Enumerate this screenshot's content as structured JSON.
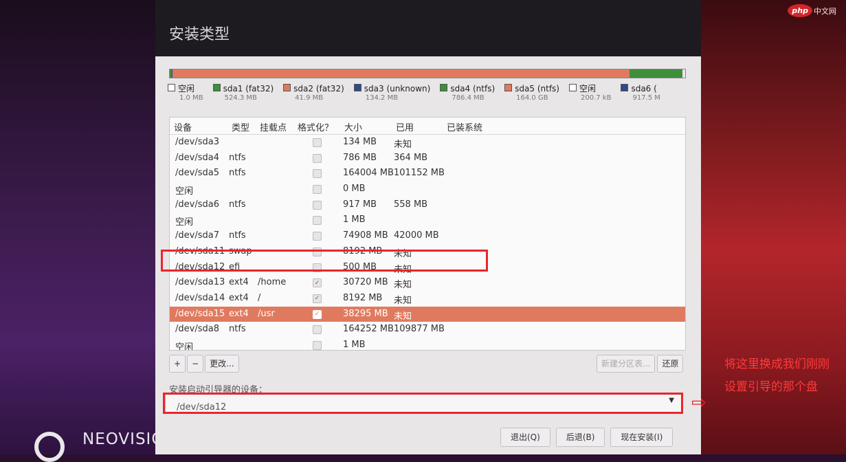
{
  "page": {
    "title": "安装类型"
  },
  "watermark": {
    "logo_text": "php",
    "logo_suffix": "中文网",
    "brand": "NEOVISION"
  },
  "disk_bar": {
    "segments": [
      {
        "color": "#cfcfcf",
        "frac": 0.0005
      },
      {
        "color": "#3e8e3a",
        "frac": 0.003
      },
      {
        "color": "#e07a5f",
        "frac": 0.0007
      },
      {
        "color": "#2e4b8a",
        "frac": 0.0005
      },
      {
        "color": "#3e8e3a",
        "frac": 0.0005
      },
      {
        "color": "#e07a5f",
        "frac": 0.887
      },
      {
        "color": "#3e8e3a",
        "frac": 0.103
      }
    ]
  },
  "legend": [
    {
      "name": "空闲",
      "size": "1.0 MB",
      "color": "#ffffff"
    },
    {
      "name": "sda1 (fat32)",
      "size": "524.3 MB",
      "color": "#3e8e3a"
    },
    {
      "name": "sda2 (fat32)",
      "size": "41.9 MB",
      "color": "#e07a5f"
    },
    {
      "name": "sda3 (unknown)",
      "size": "134.2 MB",
      "color": "#2e4b8a"
    },
    {
      "name": "sda4 (ntfs)",
      "size": "786.4 MB",
      "color": "#3e8e3a"
    },
    {
      "name": "sda5 (ntfs)",
      "size": "164.0 GB",
      "color": "#e07a5f"
    },
    {
      "name": "空闲",
      "size": "200.7 kB",
      "color": "#ffffff"
    },
    {
      "name": "sda6 (",
      "size": "917.5 M",
      "color": "#2e4b8a"
    }
  ],
  "table": {
    "headers": {
      "device": "设备",
      "type": "类型",
      "mount": "挂载点",
      "format": "格式化？",
      "size": "大小",
      "used": "已用",
      "installed": "已装系统"
    },
    "rows": [
      {
        "device": "/dev/sda3",
        "type": "",
        "mount": "",
        "format": false,
        "size": "134 MB",
        "used": "未知"
      },
      {
        "device": "/dev/sda4",
        "type": "ntfs",
        "mount": "",
        "format": false,
        "size": "786 MB",
        "used": "364 MB"
      },
      {
        "device": "/dev/sda5",
        "type": "ntfs",
        "mount": "",
        "format": false,
        "size": "164004 MB",
        "used": "101152 MB"
      },
      {
        "device": "空闲",
        "type": "",
        "mount": "",
        "format": false,
        "size": "0 MB",
        "used": ""
      },
      {
        "device": "/dev/sda6",
        "type": "ntfs",
        "mount": "",
        "format": false,
        "size": "917 MB",
        "used": "558 MB"
      },
      {
        "device": "空闲",
        "type": "",
        "mount": "",
        "format": false,
        "size": "1 MB",
        "used": ""
      },
      {
        "device": "/dev/sda7",
        "type": "ntfs",
        "mount": "",
        "format": false,
        "size": "74908 MB",
        "used": "42000 MB"
      },
      {
        "device": "/dev/sda11",
        "type": "swap",
        "mount": "",
        "format": false,
        "size": "8192 MB",
        "used": "未知"
      },
      {
        "device": "/dev/sda12",
        "type": "efi",
        "mount": "",
        "format": false,
        "size": "500 MB",
        "used": "未知"
      },
      {
        "device": "/dev/sda13",
        "type": "ext4",
        "mount": "/home",
        "format": true,
        "size": "30720 MB",
        "used": "未知"
      },
      {
        "device": "/dev/sda14",
        "type": "ext4",
        "mount": "/",
        "format": true,
        "size": "8192 MB",
        "used": "未知"
      },
      {
        "device": "/dev/sda15",
        "type": "ext4",
        "mount": "/usr",
        "format": true,
        "size": "38295 MB",
        "used": "未知",
        "selected": true
      },
      {
        "device": "/dev/sda8",
        "type": "ntfs",
        "mount": "",
        "format": false,
        "size": "164252 MB",
        "used": "109877 MB"
      },
      {
        "device": "空闲",
        "type": "",
        "mount": "",
        "format": false,
        "size": "1 MB",
        "used": ""
      }
    ]
  },
  "table_buttons": {
    "add": "+",
    "remove": "−",
    "change": "更改...",
    "new_table": "新建分区表...",
    "revert": "还原"
  },
  "bootloader": {
    "label": "安装启动引导器的设备：",
    "value": "/dev/sda12"
  },
  "bottom_buttons": {
    "quit": "退出(Q)",
    "back": "后退(B)",
    "install": "现在安装(I)"
  },
  "annotation": {
    "text": "将这里换成我们刚刚设置引导的那个盘",
    "arrow": "⇨"
  }
}
